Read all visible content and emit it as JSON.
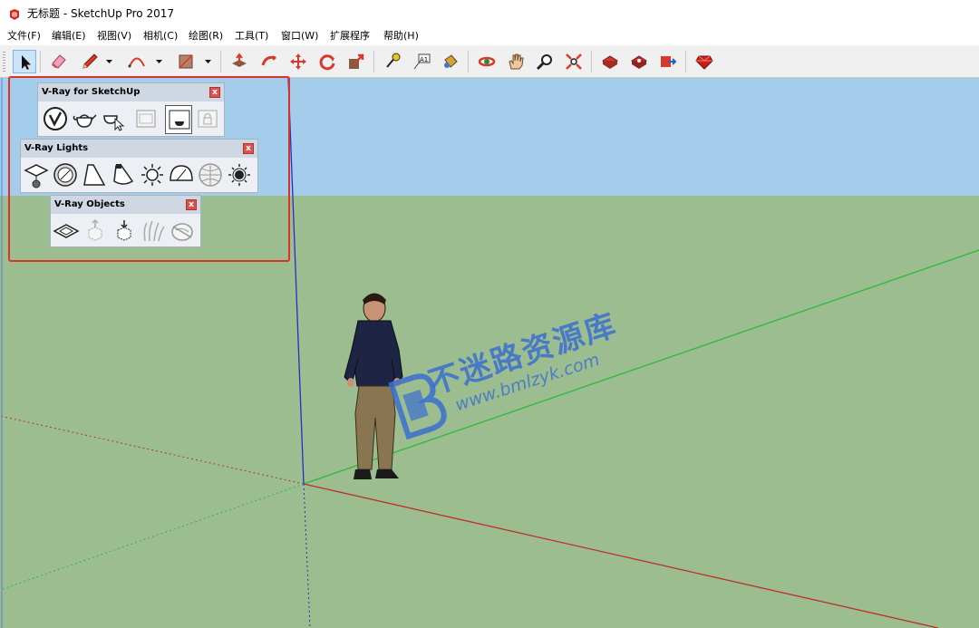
{
  "window": {
    "title": "无标题 - SketchUp Pro 2017"
  },
  "menu": {
    "items": [
      "文件(F)",
      "编辑(E)",
      "视图(V)",
      "相机(C)",
      "绘图(R)",
      "工具(T)",
      "窗口(W)",
      "扩展程序",
      "帮助(H)"
    ]
  },
  "toolbar": {
    "tools": [
      {
        "icon": "select-arrow-icon",
        "active": true
      },
      {
        "icon": "eraser-icon"
      },
      {
        "icon": "pencil-line-icon"
      },
      {
        "icon": "arc-icon"
      },
      {
        "icon": "rectangle-shape-icon"
      },
      {
        "icon": "push-pull-icon"
      },
      {
        "icon": "follow-me-icon"
      },
      {
        "icon": "move-icon"
      },
      {
        "icon": "rotate-icon"
      },
      {
        "icon": "scale-icon"
      },
      {
        "icon": "tape-measure-icon"
      },
      {
        "icon": "text-label-icon"
      },
      {
        "icon": "paint-bucket-icon"
      },
      {
        "icon": "orbit-icon"
      },
      {
        "icon": "pan-hand-icon"
      },
      {
        "icon": "zoom-icon"
      },
      {
        "icon": "zoom-extents-icon"
      },
      {
        "icon": "warehouse-icon"
      },
      {
        "icon": "extension-warehouse-icon"
      },
      {
        "icon": "share-model-icon"
      },
      {
        "icon": "ruby-console-icon"
      }
    ]
  },
  "vray_panels": [
    {
      "title": "V-Ray for SketchUp",
      "close": "x",
      "buttons": [
        "vray-logo-icon",
        "teapot-render-icon",
        "interactive-render-icon",
        "frame-buffer-icon",
        "render-region-icon",
        "lock-icon"
      ]
    },
    {
      "title": "V-Ray Lights",
      "close": "x",
      "buttons": [
        "rect-light-icon",
        "sphere-light-icon",
        "spot-light-icon",
        "ies-light-icon",
        "omni-light-icon",
        "dome-light-icon",
        "mesh-light-icon",
        "sun-light-icon"
      ]
    },
    {
      "title": "V-Ray Objects",
      "close": "x",
      "buttons": [
        "infinite-plane-icon",
        "proxy-export-icon",
        "proxy-import-icon",
        "fur-icon",
        "mesh-clipper-icon"
      ]
    }
  ],
  "watermark": {
    "text": "不迷路资源库",
    "url": "www.bmlzyk.com"
  },
  "colors": {
    "sky": "#a4cdec",
    "ground": "#9bbd8f",
    "highlight": "#e0302a",
    "axis_red": "#c0302b",
    "axis_green": "#2fb93a",
    "axis_blue": "#2030c8"
  }
}
